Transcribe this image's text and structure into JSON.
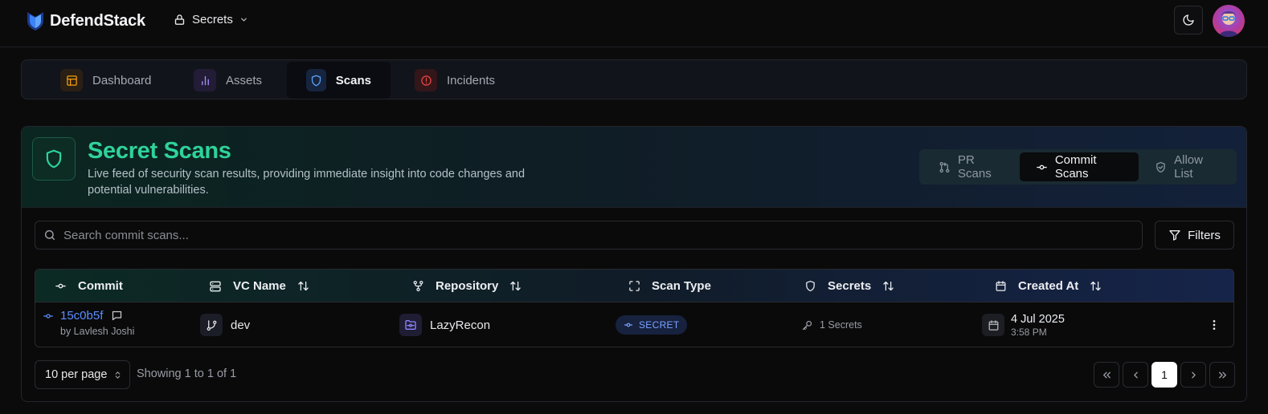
{
  "brand": {
    "name": "DefendStack"
  },
  "product_menu": {
    "label": "Secrets"
  },
  "nav": {
    "items": [
      {
        "label": "Dashboard",
        "icon": "layout-icon",
        "color": "#f59e0b"
      },
      {
        "label": "Assets",
        "icon": "bar-chart-icon",
        "color": "#a78bfa"
      },
      {
        "label": "Scans",
        "icon": "shield-icon",
        "color": "#60a5fa",
        "active": true
      },
      {
        "label": "Incidents",
        "icon": "alert-circle-icon",
        "color": "#ef4444"
      }
    ]
  },
  "header": {
    "title": "Secret Scans",
    "subtitle": "Live feed of security scan results, providing immediate insight into code changes and potential vulnerabilities.",
    "tabs": [
      {
        "label": "PR Scans",
        "icon": "git-pull-request-icon"
      },
      {
        "label": "Commit Scans",
        "icon": "git-commit-icon",
        "active": true
      },
      {
        "label": "Allow List",
        "icon": "shield-check-icon"
      }
    ]
  },
  "search": {
    "placeholder": "Search commit scans...",
    "value": ""
  },
  "filters": {
    "label": "Filters"
  },
  "table": {
    "columns": [
      "Commit",
      "VC Name",
      "Repository",
      "Scan Type",
      "Secrets",
      "Created At"
    ],
    "rows": [
      {
        "commit": "15c0b5f",
        "author": "by Lavlesh Joshi",
        "vc_name": "dev",
        "repository": "LazyRecon",
        "scan_type": "SECRET",
        "secrets": "1 Secrets",
        "created_date": "4 Jul 2025",
        "created_time": "3:58 PM"
      }
    ]
  },
  "pagination": {
    "per_page": "10 per page",
    "showing": "Showing 1 to 1 of 1",
    "current_page": "1"
  },
  "colors": {
    "accent_green": "#2ed39a",
    "link_blue": "#5b8dff"
  }
}
